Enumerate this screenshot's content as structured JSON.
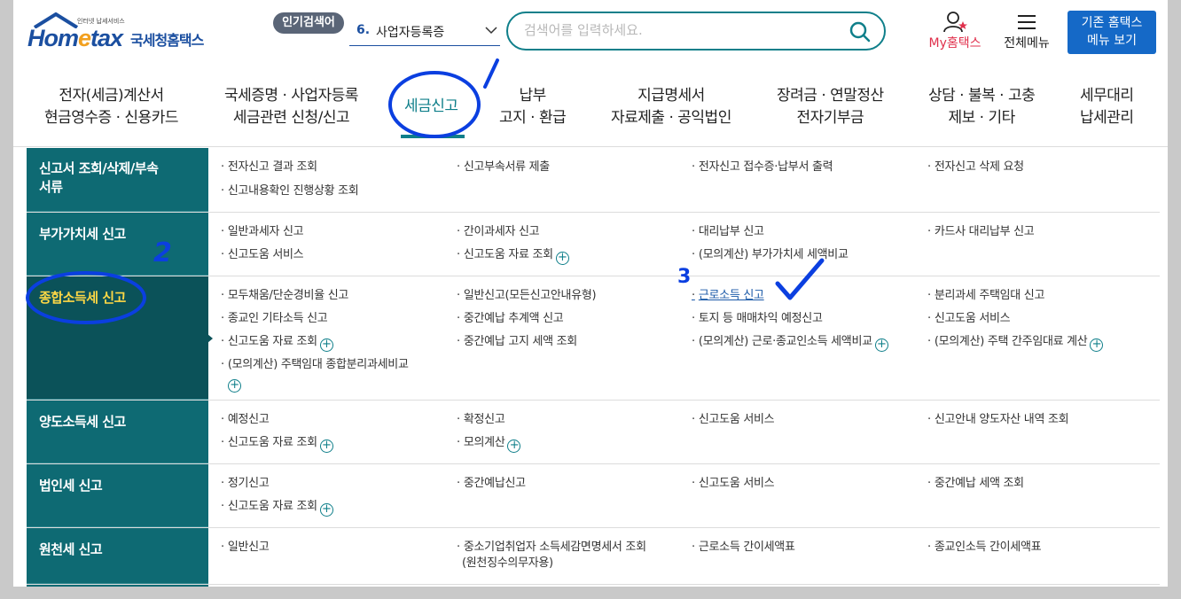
{
  "header": {
    "logo_tagline": "인터넷 납세서비스",
    "logo_main_a": "Hom",
    "logo_main_e": "e",
    "logo_main_b": "tax",
    "logo_kr": "국세청홈택스",
    "popular_label": "인기검색어",
    "popular_rank": "6.",
    "popular_term": "사업자등록증",
    "search_placeholder": "검색어를 입력하세요.",
    "my_hometax": "My홈택스",
    "all_menu": "전체메뉴",
    "old_hometax_line1": "기존 홈택스",
    "old_hometax_line2": "메뉴 보기"
  },
  "gnb": [
    {
      "line1": "전자(세금)계산서",
      "line2": "현금영수증 · 신용카드"
    },
    {
      "line1": "국세증명 · 사업자등록",
      "line2": "세금관련 신청/신고"
    },
    {
      "line1": "세금신고",
      "line2": ""
    },
    {
      "line1": "납부",
      "line2": "고지 · 환급"
    },
    {
      "line1": "지급명세서",
      "line2": "자료제출 · 공익법인"
    },
    {
      "line1": "장려금 · 연말정산",
      "line2": "전자기부금"
    },
    {
      "line1": "상담 · 불복 · 고충",
      "line2": "제보 · 기타"
    },
    {
      "line1": "세무대리",
      "line2": "납세관리"
    }
  ],
  "annotations": {
    "step2": "2",
    "step3": "3"
  },
  "menu": {
    "r0": {
      "head": "신고서 조회/삭제/부속서류",
      "l0": "전자신고 결과 조회",
      "l1": "신고부속서류 제출",
      "l2": "전자신고 접수증·납부서 출력",
      "l3": "전자신고 삭제 요청",
      "l4": "신고내용확인 진행상황 조회"
    },
    "r1": {
      "head": "부가가치세 신고",
      "l0": "일반과세자 신고",
      "l1": "간이과세자 신고",
      "l2": "대리납부 신고",
      "l3": "카드사 대리납부 신고",
      "l4": "신고도움 서비스",
      "l5": "신고도움 자료 조회",
      "l6": "(모의계산) 부가가치세 세액비교"
    },
    "r2": {
      "head": "종합소득세 신고",
      "l0": "모두채움/단순경비율 신고",
      "l1": "일반신고(모든신고안내유형)",
      "l2": "근로소득 신고",
      "l3": "분리과세 주택임대 신고",
      "l4": "종교인 기타소득 신고",
      "l5": "중간예납 추계액 신고",
      "l6": "토지 등 매매차익 예정신고",
      "l7": "신고도움 서비스",
      "l8": "신고도움 자료 조회",
      "l9": "중간예납 고지 세액 조회",
      "l10": "(모의계산) 근로·종교인소득 세액비교",
      "l11": "(모의계산) 주택 간주임대료 계산",
      "l12": "(모의계산) 주택임대 종합분리과세비교"
    },
    "r3": {
      "head": "양도소득세 신고",
      "l0": "예정신고",
      "l1": "확정신고",
      "l2": "신고도움 서비스",
      "l3": "신고안내 양도자산 내역 조회",
      "l4": "신고도움 자료 조회",
      "l5": "모의계산"
    },
    "r4": {
      "head": "법인세 신고",
      "l0": "정기신고",
      "l1": "중간예납신고",
      "l2": "신고도움 서비스",
      "l3": "중간예납 세액 조회",
      "l4": "신고도움 자료 조회"
    },
    "r5": {
      "head": "원천세 신고",
      "l0": "일반신고",
      "l1": "중소기업취업자 소득세감면명세서 조회",
      "l1b": "(원천징수의무자용)",
      "l2": "근로소득 간이세액표",
      "l3": "종교인소득 간이세액표"
    }
  },
  "colors": {
    "teal": "#0e6a73",
    "teal_dark": "#0b5259",
    "active_head_text": "#ffd845",
    "brand_blue": "#1b4fa0",
    "annotation_blue": "#0b3fe0"
  }
}
